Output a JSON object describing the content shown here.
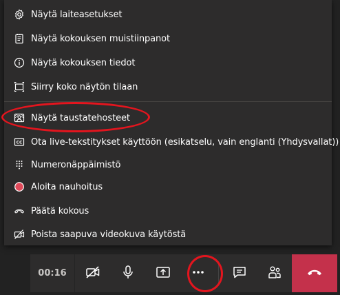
{
  "menu": {
    "items": [
      {
        "label": "Näytä laiteasetukset",
        "icon": "gear-icon"
      },
      {
        "label": "Näytä kokouksen muistiinpanot",
        "icon": "notes-icon"
      },
      {
        "label": "Näytä kokouksen tiedot",
        "icon": "info-icon"
      },
      {
        "label": "Siirry koko näytön tilaan",
        "icon": "fullscreen-icon"
      },
      {
        "label": "Näytä taustatehosteet",
        "icon": "background-effects-icon"
      },
      {
        "label": "Ota live-tekstitykset käyttöön (esikatselu, vain englanti (Yhdysvallat))",
        "icon": "captions-icon"
      },
      {
        "label": "Numeronäppäimistö",
        "icon": "dialpad-icon"
      },
      {
        "label": "Aloita nauhoitus",
        "icon": "record-icon"
      },
      {
        "label": "Päätä kokous",
        "icon": "end-meeting-icon"
      },
      {
        "label": "Poista saapuva videokuva käytöstä",
        "icon": "video-off-icon"
      }
    ]
  },
  "toolbar": {
    "timer": "00:16"
  },
  "colors": {
    "menu_bg": "#2d2c2c",
    "hangup": "#c4314b",
    "record_dot": "#e04a5a",
    "annotation": "#e3151e"
  }
}
